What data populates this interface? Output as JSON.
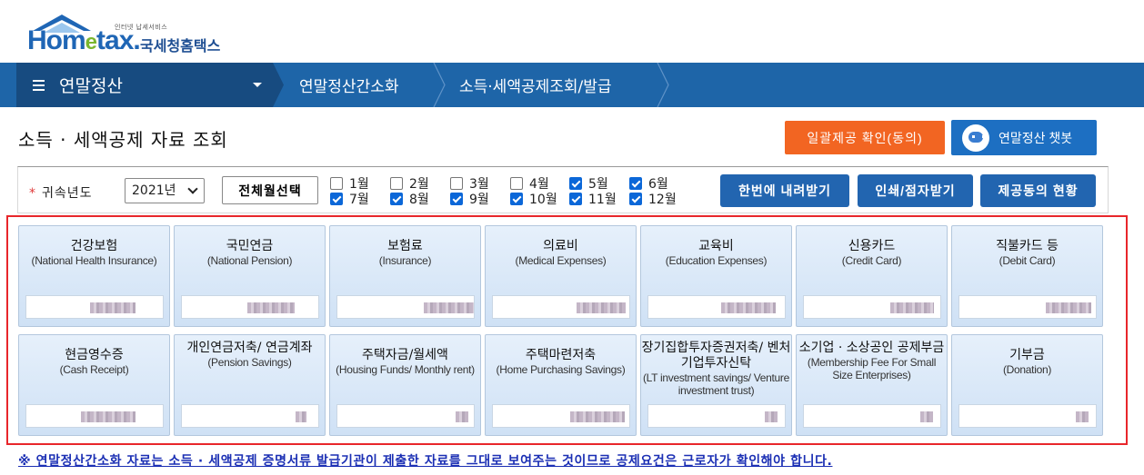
{
  "logo": {
    "tagline": "인터넷 납세서비스",
    "word_main": "Hom",
    "word_e": "e",
    "word_tail": "tax.",
    "korean": "국세청홈택스"
  },
  "nav": {
    "menu_label": "연말정산",
    "crumbs": [
      "연말정산간소화",
      "소득·세액공제조회/발급"
    ]
  },
  "page": {
    "title": "소득 · 세액공제 자료 조회",
    "consent_button": "일괄제공 확인(동의)",
    "chatbot_button": "연말정산 챗봇"
  },
  "filter": {
    "year_label": "귀속년도",
    "year_value": "2021년",
    "select_all_button": "전체월선택",
    "months": [
      {
        "label": "1월",
        "checked": false
      },
      {
        "label": "2월",
        "checked": false
      },
      {
        "label": "3월",
        "checked": false
      },
      {
        "label": "4월",
        "checked": false
      },
      {
        "label": "5월",
        "checked": true
      },
      {
        "label": "6월",
        "checked": true
      },
      {
        "label": "7월",
        "checked": true
      },
      {
        "label": "8월",
        "checked": true
      },
      {
        "label": "9월",
        "checked": true
      },
      {
        "label": "10월",
        "checked": true
      },
      {
        "label": "11월",
        "checked": true
      },
      {
        "label": "12월",
        "checked": true
      }
    ],
    "download_all_button": "한번에 내려받기",
    "print_button": "인쇄/점자받기",
    "consent_status_button": "제공동의 현황"
  },
  "tiles_row1": [
    {
      "title": "건강보험",
      "en": "(National Health Insurance)"
    },
    {
      "title": "국민연금",
      "en": "(National Pension)"
    },
    {
      "title": "보험료",
      "en": "(Insurance)"
    },
    {
      "title": "의료비",
      "en": "(Medical Expenses)"
    },
    {
      "title": "교육비",
      "en": "(Education Expenses)"
    },
    {
      "title": "신용카드",
      "en": "(Credit Card)"
    },
    {
      "title": "직불카드 등",
      "en": "(Debit Card)"
    }
  ],
  "tiles_row2": [
    {
      "title": "현금영수증",
      "en": "(Cash Receipt)"
    },
    {
      "title": "개인연금저축/ 연금계좌",
      "en": "(Pension Savings)"
    },
    {
      "title": "주택자금/월세액",
      "en": "(Housing Funds/ Monthly rent)"
    },
    {
      "title": "주택마련저축",
      "en": "(Home Purchasing Savings)"
    },
    {
      "title": "장기집합투자증권저축/ 벤처기업투자신탁",
      "en": "(LT investment savings/ Venture investment trust)"
    },
    {
      "title": "소기업 · 소상공인 공제부금",
      "en": "(Membership Fee For Small Size Enterprises)"
    },
    {
      "title": "기부금",
      "en": "(Donation)"
    }
  ],
  "note": "※ 연말정산간소화 자료는 소득 · 세액공제 증명서류 발급기관이 제출한 자료를 그대로 보여주는 것이므로 공제요건은 근로자가 확인해야 합니다.",
  "colors": {
    "nav_blue": "#1e65a8",
    "nav_dark": "#174b80",
    "orange": "#f26522",
    "button_blue": "#2265b0",
    "highlight_red": "#e8262b",
    "note_blue": "#1b2fb4"
  }
}
